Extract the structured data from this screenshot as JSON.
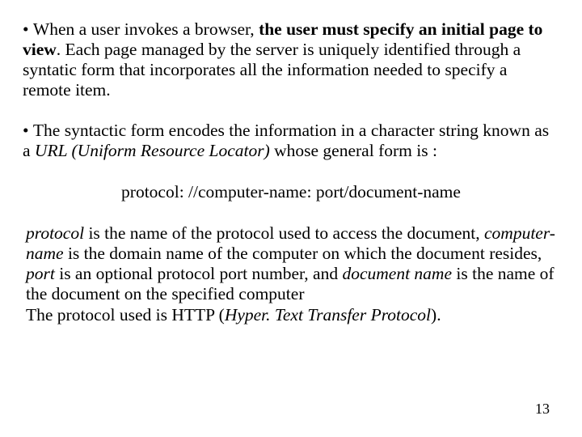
{
  "para1": {
    "lead": "When a user invokes a browser, ",
    "bold": "the user must specify an initial page to view",
    "tail": ". Each page managed by the server is uniquely identified through a syntatic form that incorporates all the information needed to specify a remote item."
  },
  "para2": {
    "lead": "The syntactic form encodes the information in a character string known as a  ",
    "italic": "URL (Uniform Resource Locator)",
    "tail": " whose general form is :"
  },
  "urlform": "protocol: //computer-name: port/document-name",
  "desc": {
    "w1": "protocol",
    "t1": " is the name of the protocol used to access the document, ",
    "w2": "computer-name",
    "t2": " is the domain name of the computer on which the document resides, ",
    "w3": "port",
    "t3": " is an optional protocol port number, and ",
    "w4": "document name",
    "t4": " is the name of the document on the specified computer",
    "line2a": " The protocol used is HTTP (",
    "line2i": "Hyper. Text Transfer Protocol",
    "line2b": ")."
  },
  "pagenum": "13"
}
